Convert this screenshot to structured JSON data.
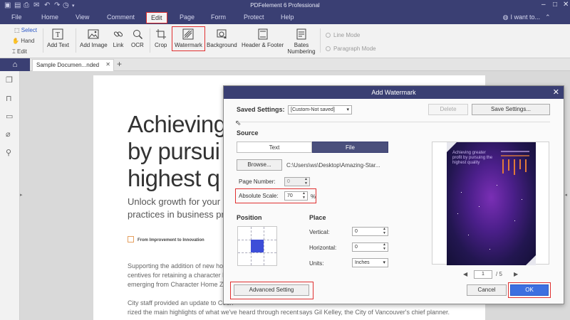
{
  "app": {
    "title": "PDFelement 6 Professional"
  },
  "menu": {
    "items": [
      "File",
      "Home",
      "View",
      "Comment",
      "Edit",
      "Page",
      "Form",
      "Protect",
      "Help"
    ],
    "active": "Edit",
    "search_label": "I want to..."
  },
  "ribbon": {
    "modes": [
      "Select",
      "Hand",
      "Edit"
    ],
    "tools": {
      "add_text": "Add Text",
      "add_image": "Add Image",
      "link": "Link",
      "ocr": "OCR",
      "crop": "Crop",
      "watermark": "Watermark",
      "background": "Background",
      "header_footer": "Header & Footer",
      "bates": "Bates Numbering"
    },
    "line_mode": "Line Mode",
    "paragraph_mode": "Paragraph Mode"
  },
  "tabs": {
    "doc_tab": "Sample Documen...nded"
  },
  "document": {
    "title_lines": [
      "Achieving",
      "by pursui",
      "highest q"
    ],
    "subtitle_lines": [
      "Unlock growth for your com",
      "practices in business proces"
    ],
    "tag": "From Improvement to Innovation",
    "para1": [
      "Supporting the addition of new housin",
      "centives for retaining a character hom",
      "emerging from Character Home Zonin"
    ],
    "para2": [
      "City staff provided an update to Coun",
      "rized the main highlights of what we've heard through recent"
    ],
    "quote": "says Gil Kelley, the City of Vancouver's chief planner."
  },
  "dialog": {
    "title": "Add Watermark",
    "saved_settings_label": "Saved Settings:",
    "saved_settings_value": "[Custom-Not saved]",
    "delete": "Delete",
    "save_settings": "Save Settings...",
    "source_label": "Source",
    "source_text": "Text",
    "source_file": "File",
    "browse": "Browse...",
    "file_path": "C:\\Users\\ws\\Desktop\\Amazing-Star...",
    "page_number_label": "Page Number:",
    "page_number_value": "0",
    "absolute_scale_label": "Absolute Scale:",
    "absolute_scale_value": "70",
    "percent": "%",
    "position_label": "Position",
    "place_label": "Place",
    "vertical_label": "Vertical:",
    "vertical_value": "0",
    "horizontal_label": "Horizontal:",
    "horizontal_value": "0",
    "units_label": "Units:",
    "units_value": "Inches",
    "advanced": "Advanced Setting",
    "preview_page": "1",
    "preview_total": "/ 5",
    "cancel": "Cancel",
    "ok": "OK",
    "preview_lines": [
      "Achieving greater",
      "profit by pursuing the",
      "highest quality"
    ]
  }
}
